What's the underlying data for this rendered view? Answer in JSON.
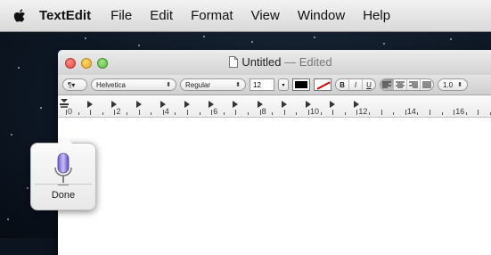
{
  "menubar": {
    "apple_icon": "apple-logo-icon",
    "app_name": "TextEdit",
    "menus": [
      "File",
      "Edit",
      "Format",
      "View",
      "Window",
      "Help"
    ]
  },
  "window": {
    "doc_icon": "document-icon",
    "title": "Untitled",
    "edited": "— Edited"
  },
  "toolbar": {
    "paragraph_style": "¶▾",
    "font_family": "Helvetica",
    "font_style": "Regular",
    "font_size": "12",
    "size_arrow": "▾",
    "bold": "B",
    "italic": "I",
    "underline": "U",
    "line_spacing": "1.0",
    "text_color": "#000000"
  },
  "ruler": {
    "labels": [
      "0",
      "2",
      "4",
      "6",
      "8",
      "10",
      "12",
      "14",
      "16"
    ]
  },
  "dictation": {
    "icon": "microphone-icon",
    "done_label": "Done"
  }
}
